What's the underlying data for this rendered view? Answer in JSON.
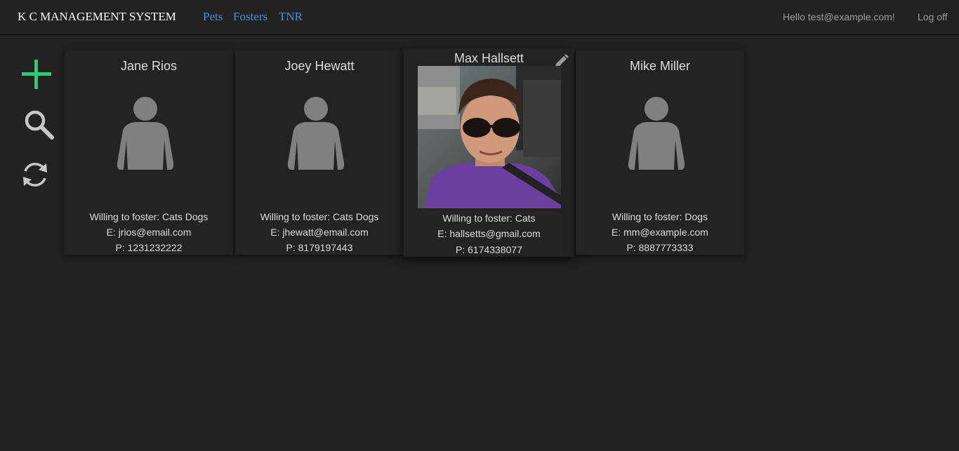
{
  "navbar": {
    "brand": "K C MANAGEMENT SYSTEM",
    "links": [
      {
        "label": "Pets"
      },
      {
        "label": "Fosters"
      },
      {
        "label": "TNR"
      }
    ],
    "greeting": "Hello test@example.com!",
    "logoff": "Log off"
  },
  "sidebar": {
    "add_icon": "plus-icon",
    "search_icon": "search-icon",
    "refresh_icon": "refresh-icon",
    "add_color": "#2ecc71"
  },
  "fosters": [
    {
      "name": "Jane Rios",
      "willing": "Willing to foster: Cats Dogs",
      "email": "E: jrios@email.com",
      "phone": "P: 1231232222",
      "has_photo": false
    },
    {
      "name": "Joey Hewatt",
      "willing": "Willing to foster: Cats Dogs",
      "email": "E: jhewatt@email.com",
      "phone": "P: 8179197443",
      "has_photo": false
    },
    {
      "name": "Max Hallsett",
      "willing": "Willing to foster: Cats",
      "email": "E: hallsetts@gmail.com",
      "phone": "P: 6174338077",
      "has_photo": true
    },
    {
      "name": "Mike Miller",
      "willing": "Willing to foster: Dogs",
      "email": "E: mm@example.com",
      "phone": "P: 8887773333",
      "has_photo": false
    }
  ],
  "colors": {
    "background": "#222222",
    "link": "#4a90e2",
    "placeholder_avatar": "#808080"
  }
}
